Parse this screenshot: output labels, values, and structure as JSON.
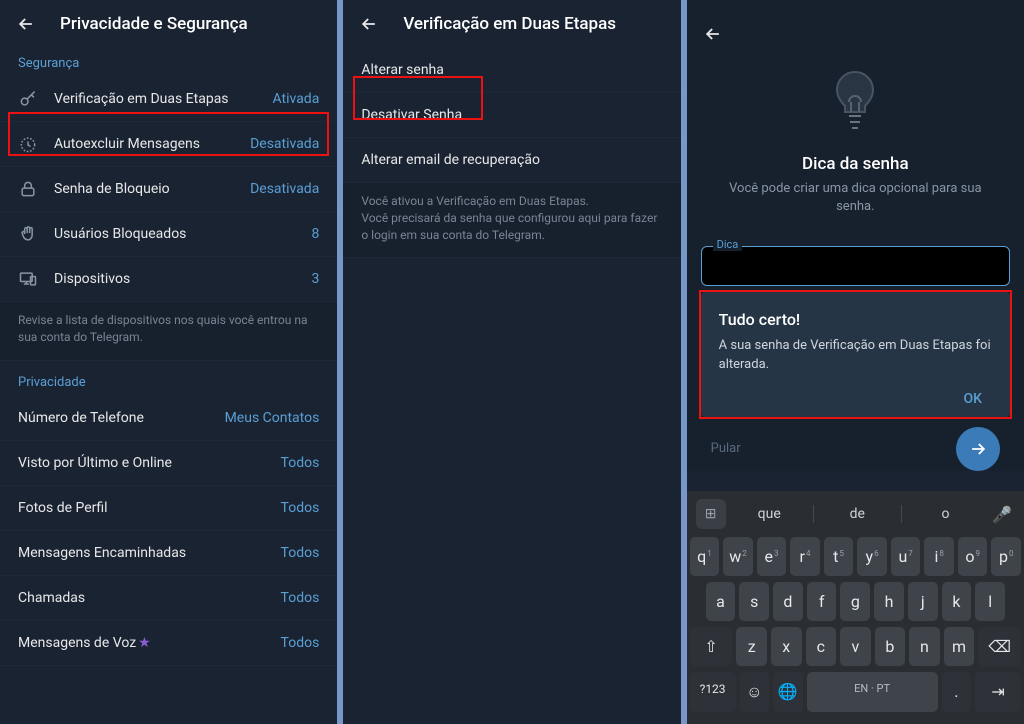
{
  "panel1": {
    "title": "Privacidade e Segurança",
    "section_security": "Segurança",
    "items_security": [
      {
        "label": "Verificação em Duas Etapas",
        "value": "Ativada"
      },
      {
        "label": "Autoexcluir Mensagens",
        "value": "Desativada"
      },
      {
        "label": "Senha de Bloqueio",
        "value": "Desativada"
      },
      {
        "label": "Usuários Bloqueados",
        "value": "8"
      },
      {
        "label": "Dispositivos",
        "value": "3"
      }
    ],
    "devices_hint": "Revise a lista de dispositivos nos quais você entrou na sua conta do Telegram.",
    "section_privacy": "Privacidade",
    "items_privacy": [
      {
        "label": "Número de Telefone",
        "value": "Meus Contatos"
      },
      {
        "label": "Visto por Último e Online",
        "value": "Todos"
      },
      {
        "label": "Fotos de Perfil",
        "value": "Todos"
      },
      {
        "label": "Mensagens Encaminhadas",
        "value": "Todos"
      },
      {
        "label": "Chamadas",
        "value": "Todos"
      },
      {
        "label": "Mensagens de Voz",
        "value": "Todos",
        "star": true
      }
    ]
  },
  "panel2": {
    "title": "Verificação em Duas Etapas",
    "items": [
      "Alterar senha",
      "Desativar Senha",
      "Alterar email de recuperação"
    ],
    "hint": "Você ativou a Verificação em Duas Etapas.\nVocê precisará da senha que configurou aqui para fazer o login em sua conta do Telegram."
  },
  "panel3": {
    "title": "Dica da senha",
    "subtitle": "Você pode criar uma dica opcional para sua senha.",
    "field_label": "Dica",
    "dialog_title": "Tudo certo!",
    "dialog_body": "A sua senha de Verificação em Duas Etapas foi alterada.",
    "dialog_ok": "OK",
    "skip": "Pular",
    "suggestions": [
      "que",
      "de",
      "o"
    ],
    "keys_row1": [
      "q",
      "w",
      "e",
      "r",
      "t",
      "y",
      "u",
      "i",
      "o",
      "p"
    ],
    "keys_row1_sup": [
      "1",
      "2",
      "3",
      "4",
      "5",
      "6",
      "7",
      "8",
      "9",
      "0"
    ],
    "keys_row2": [
      "a",
      "s",
      "d",
      "f",
      "g",
      "h",
      "j",
      "k",
      "l"
    ],
    "keys_row3": [
      "z",
      "x",
      "c",
      "v",
      "b",
      "n",
      "m"
    ],
    "shift_label": "⇧",
    "backspace_label": "⌫",
    "num_label": "?123",
    "emoji_label": "☺",
    "lang_label": "🌐",
    "space_label": "EN · PT",
    "period_label": ".",
    "enter_label": "→"
  }
}
